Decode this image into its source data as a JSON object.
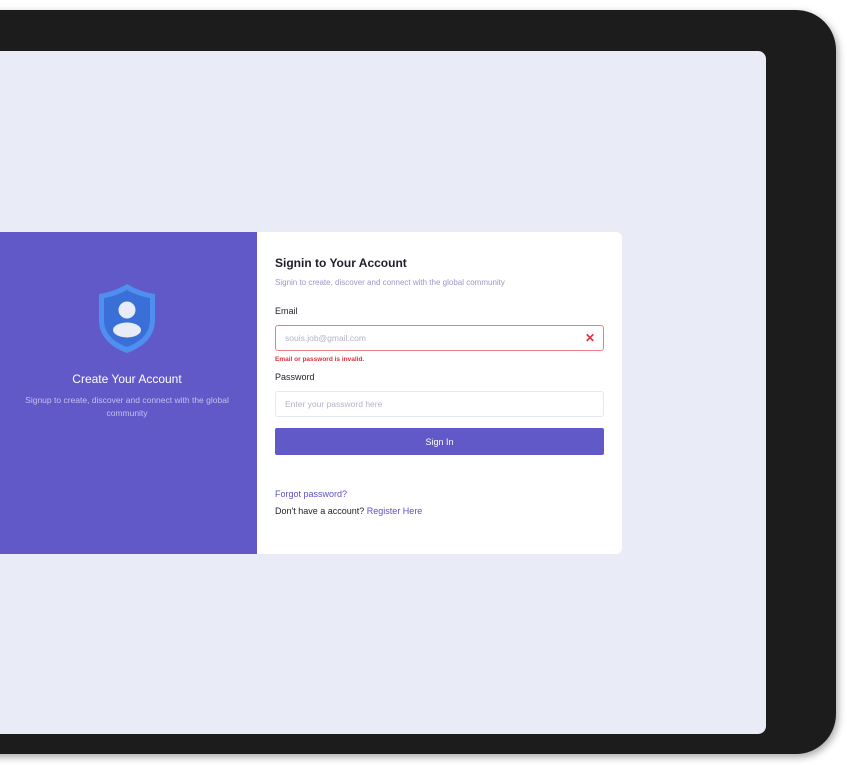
{
  "colors": {
    "accent": "#6259c9",
    "screen_bg": "#e9ebf6",
    "error": "#e0313f"
  },
  "left_panel": {
    "icon": "shield-user-icon",
    "title": "Create Your Account",
    "subtitle": "Signup to create, discover and connect with the global community"
  },
  "form": {
    "title": "Signin to Your Account",
    "subtitle": "Signin to create, discover and connect with the global community",
    "email": {
      "label": "Email",
      "placeholder": "souis.job@gmail.com",
      "clear_icon": "close-icon",
      "clear_glyph": "✕",
      "error": "Email or password is invalid."
    },
    "password": {
      "label": "Password",
      "placeholder": "Enter your password here"
    },
    "submit_label": "Sign In",
    "forgot_label": "Forgot password?",
    "register_prompt": "Don't have a account?",
    "register_label": "Register Here"
  }
}
